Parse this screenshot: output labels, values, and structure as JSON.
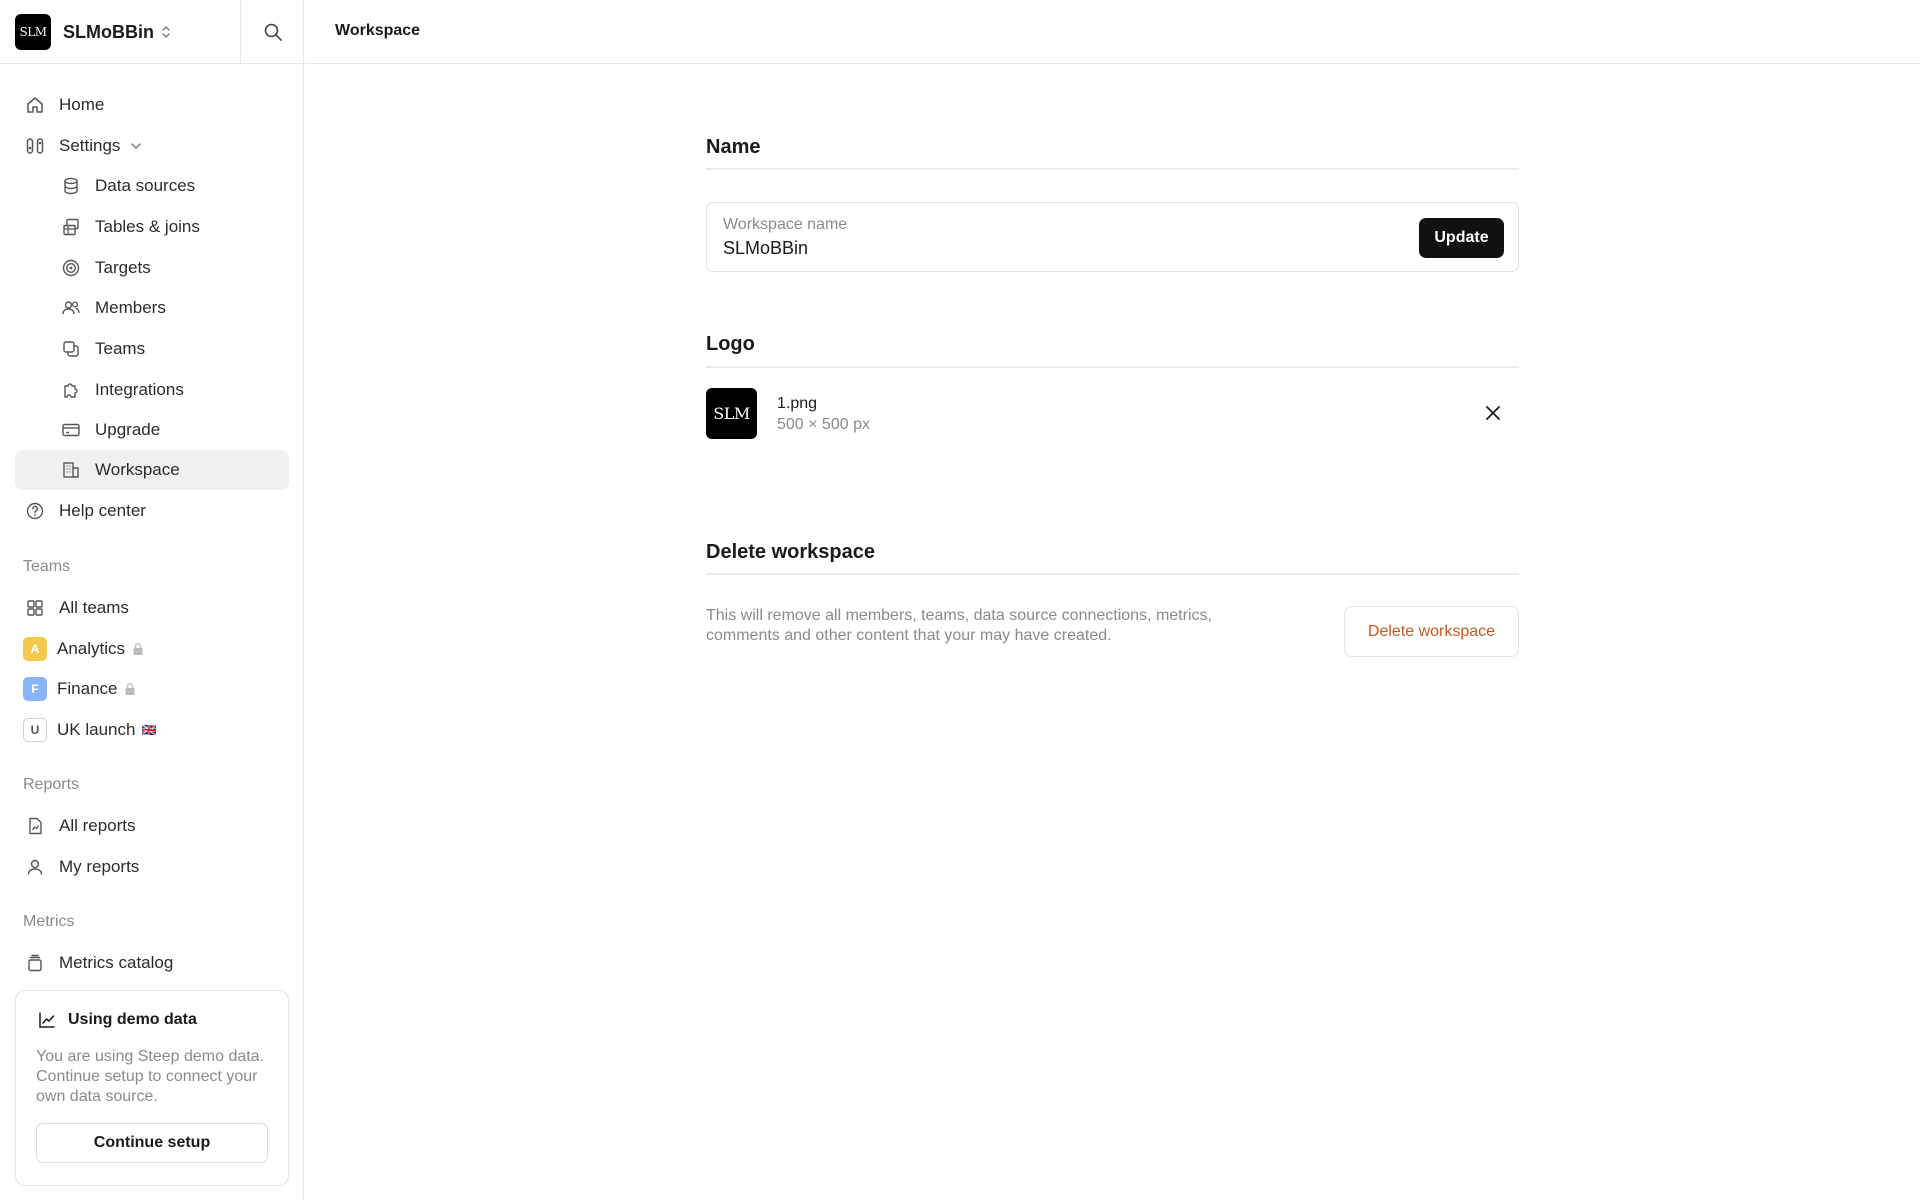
{
  "workspace": {
    "name": "SLMoBBin",
    "logo_text": "SLM"
  },
  "sidebar": {
    "nav": [
      {
        "label": "Home",
        "icon": "home-icon"
      },
      {
        "label": "Settings",
        "icon": "settings-icon"
      }
    ],
    "settings_items": [
      {
        "label": "Data sources",
        "icon": "database-icon"
      },
      {
        "label": "Tables & joins",
        "icon": "tables-icon"
      },
      {
        "label": "Targets",
        "icon": "target-icon"
      },
      {
        "label": "Members",
        "icon": "members-icon"
      },
      {
        "label": "Teams",
        "icon": "teams-icon"
      },
      {
        "label": "Integrations",
        "icon": "puzzle-icon"
      },
      {
        "label": "Upgrade",
        "icon": "credit-card-icon"
      },
      {
        "label": "Workspace",
        "icon": "building-icon",
        "active": true
      }
    ],
    "help": {
      "label": "Help center",
      "icon": "help-icon"
    },
    "teams_section": {
      "title": "Teams",
      "items": [
        {
          "label": "All teams",
          "icon": "grid-icon"
        },
        {
          "label": "Analytics",
          "badge": "A",
          "badge_color": "#f6c84c",
          "locked": true
        },
        {
          "label": "Finance",
          "badge": "F",
          "badge_color": "#8ab4f8",
          "locked": true
        },
        {
          "label": "UK launch",
          "badge": "U",
          "badge_color": "#ffffff",
          "flag": "🇬🇧"
        }
      ]
    },
    "reports_section": {
      "title": "Reports",
      "items": [
        {
          "label": "All reports",
          "icon": "report-icon"
        },
        {
          "label": "My reports",
          "icon": "user-icon"
        }
      ]
    },
    "metrics_section": {
      "title": "Metrics",
      "items": [
        {
          "label": "Metrics catalog",
          "icon": "catalog-icon"
        }
      ]
    },
    "demo": {
      "title": "Using demo data",
      "text": "You are using Steep demo data. Continue setup to connect your own data source.",
      "button": "Continue setup"
    }
  },
  "header": {
    "title": "Workspace"
  },
  "main": {
    "name_section": {
      "title": "Name",
      "field_label": "Workspace name",
      "field_value": "SLMoBBin",
      "button": "Update"
    },
    "logo_section": {
      "title": "Logo",
      "file_name": "1.png",
      "file_size": "500 × 500 px"
    },
    "delete_section": {
      "title": "Delete workspace",
      "text": "This will remove all members, teams, data source connections, metrics, comments and other content that your may have created.",
      "button": "Delete workspace"
    }
  },
  "colors": {
    "accent_danger": "#c35a1e",
    "primary_button": "#111111",
    "active_bg": "#f0f0f0"
  }
}
